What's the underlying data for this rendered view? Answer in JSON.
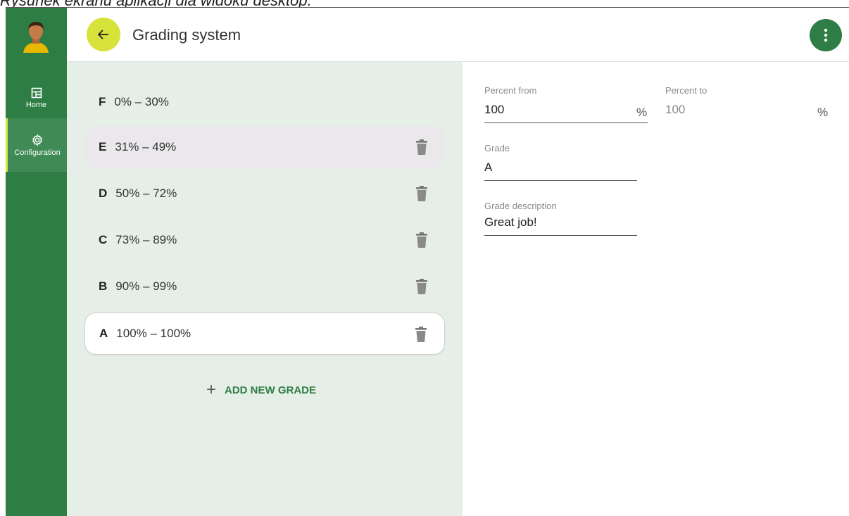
{
  "caption": "Rysunek ekranu aplikacji dla widoku desktop.",
  "nav": {
    "home_label": "Home",
    "configuration_label": "Configuration"
  },
  "header": {
    "title": "Grading system"
  },
  "grades": [
    {
      "letter": "F",
      "range": "0% – 30%",
      "deletable": false
    },
    {
      "letter": "E",
      "range": "31% – 49%",
      "deletable": true,
      "state": "hovered"
    },
    {
      "letter": "D",
      "range": "50% – 72%",
      "deletable": true
    },
    {
      "letter": "C",
      "range": "73% – 89%",
      "deletable": true
    },
    {
      "letter": "B",
      "range": "90% – 99%",
      "deletable": true
    },
    {
      "letter": "A",
      "range": "100% – 100%",
      "deletable": true,
      "state": "selected"
    }
  ],
  "add_button_label": "ADD NEW GRADE",
  "form": {
    "percent_from_label": "Percent from",
    "percent_from_value": "100",
    "percent_from_suffix": "%",
    "percent_to_label": "Percent to",
    "percent_to_value": "100",
    "percent_to_suffix": "%",
    "grade_label": "Grade",
    "grade_value": "A",
    "description_label": "Grade description",
    "description_value": "Great job!"
  },
  "colors": {
    "rail": "#2e7d45",
    "accent": "#d7e23a",
    "list_bg": "#e5efe7",
    "primary_text": "#2e7d45"
  },
  "icons": [
    "avatar",
    "dashboard-icon",
    "gear-icon",
    "arrow-left-icon",
    "more-vertical-icon",
    "trash-icon",
    "plus-icon"
  ]
}
